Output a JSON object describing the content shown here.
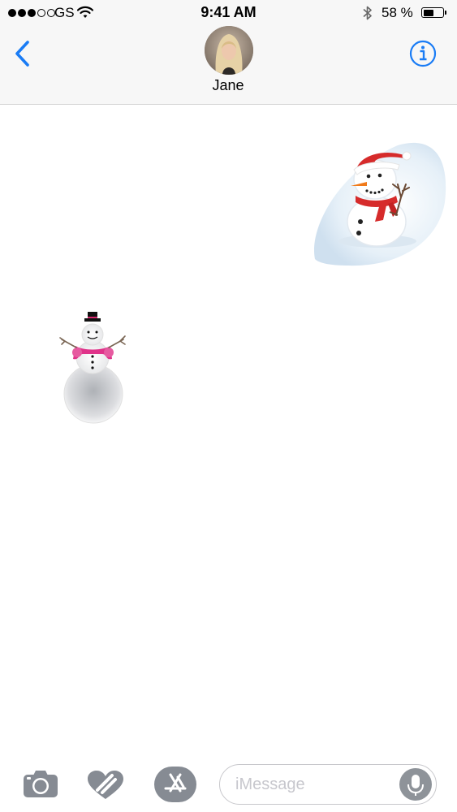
{
  "status_bar": {
    "carrier": "GS",
    "time": "9:41 AM",
    "battery_percent": "58 %",
    "battery_level": 0.58,
    "signal_bars_filled": 3,
    "signal_bars_total": 5
  },
  "nav": {
    "contact_name": "Jane",
    "back_icon": "chevron-left-icon",
    "info_icon": "info-circle-icon"
  },
  "conversation": {
    "messages": [
      {
        "direction": "sent",
        "type": "sticker",
        "sticker": "snowman-with-santa-hat-and-red-scarf"
      },
      {
        "direction": "received",
        "type": "sticker",
        "sticker": "snowman-with-top-hat-and-pink-scarf"
      }
    ]
  },
  "input_bar": {
    "placeholder": "iMessage",
    "icons": [
      "camera-icon",
      "digital-touch-icon",
      "app-store-icon",
      "microphone-icon"
    ]
  },
  "colors": {
    "accent": "#1a7cf5",
    "bar_background": "#f7f7f7",
    "input_icon_gray": "#868b93",
    "placeholder": "#c7c7cd"
  }
}
